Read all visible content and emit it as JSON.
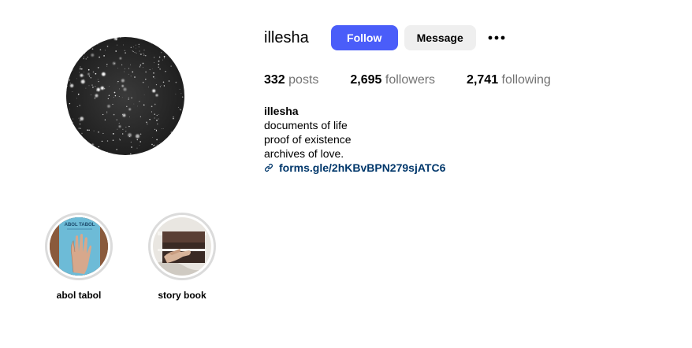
{
  "profile": {
    "username": "illesha",
    "follow_label": "Follow",
    "message_label": "Message",
    "more_icon": "more-options-icon",
    "avatar_icon": "profile-avatar"
  },
  "stats": {
    "posts_count": "332",
    "posts_label": "posts",
    "followers_count": "2,695",
    "followers_label": "followers",
    "following_count": "2,741",
    "following_label": "following"
  },
  "bio": {
    "name": "illesha",
    "lines": [
      "documents of life",
      "proof of existence",
      "archives of love."
    ],
    "link_text": "forms.gle/2hKBvBPN279sjATC6",
    "link_icon": "link-icon"
  },
  "highlights": [
    {
      "label": "abol tabol",
      "cover_text": "ABOL TABOL"
    },
    {
      "label": "story book"
    }
  ],
  "colors": {
    "follow_button": "#4a5df9",
    "message_button": "#efefef",
    "link": "#00376b",
    "muted_text": "#737373",
    "highlight_ring": "#dbdbdb"
  }
}
